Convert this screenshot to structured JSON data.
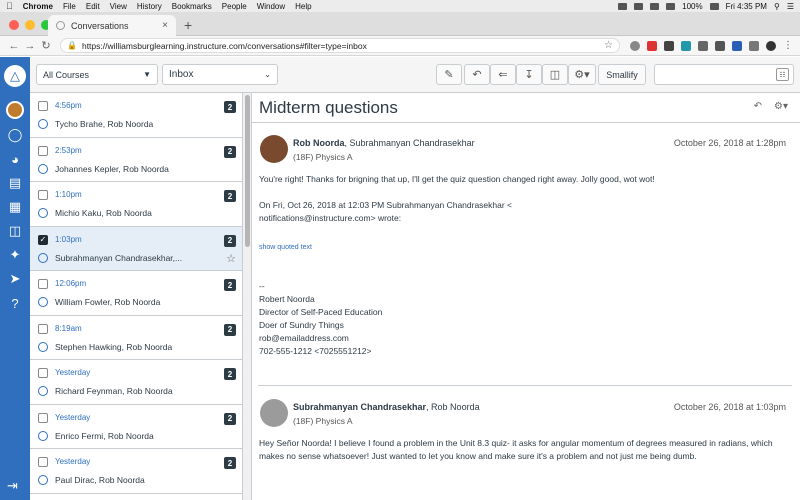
{
  "menubar": {
    "app": "Chrome",
    "items": [
      "File",
      "Edit",
      "View",
      "History",
      "Bookmarks",
      "People",
      "Window",
      "Help"
    ],
    "battery": "100%",
    "clock": "Fri 4:35 PM"
  },
  "browser": {
    "tab_title": "Conversations",
    "url": "https://williamsburglearning.instructure.com/conversations#filter=type=inbox"
  },
  "toolbar": {
    "course_filter": "All Courses",
    "mailbox_filter": "Inbox",
    "smallify_label": "Smallify",
    "search_placeholder": ""
  },
  "conversations": [
    {
      "time": "4:56pm",
      "names": "Tycho Brahe, Rob Noorda",
      "count": "2"
    },
    {
      "time": "2:53pm",
      "names": "Johannes Kepler, Rob Noorda",
      "count": "2"
    },
    {
      "time": "1:10pm",
      "names": "Michio Kaku, Rob Noorda",
      "count": "2"
    },
    {
      "time": "1:03pm",
      "names": "Subrahmanyan Chandrasekhar,...",
      "count": "2"
    },
    {
      "time": "12:06pm",
      "names": "William Fowler, Rob Noorda",
      "count": "2"
    },
    {
      "time": "8:19am",
      "names": "Stephen Hawking, Rob Noorda",
      "count": "2"
    },
    {
      "time": "Yesterday",
      "names": "Richard Feynman, Rob Noorda",
      "count": "2"
    },
    {
      "time": "Yesterday",
      "names": "Enrico Fermi, Rob Noorda",
      "count": "2"
    },
    {
      "time": "Yesterday",
      "names": "Paul Dirac, Rob Noorda",
      "count": "2"
    }
  ],
  "detail": {
    "subject": "Midterm questions",
    "messages": [
      {
        "author": "Rob Noorda",
        "recipients": ", Subrahmanyan Chandrasekhar",
        "course": "(18F) Physics A",
        "date": "October 26, 2018 at 1:28pm",
        "text": "You're right! Thanks for brigning that up, I'll get the quiz question changed right away. Jolly good, wot wot!",
        "quote_header_1": "On Fri, Oct 26, 2018 at 12:03 PM Subrahmanyan Chandrasekhar <",
        "quote_header_2": "notifications@instructure.com> wrote:",
        "show_quoted": "show quoted text",
        "sig_dash": "--",
        "sig_name": "Robert Noorda",
        "sig_title": "Director of Self-Paced Education",
        "sig_role": "Doer of Sundry Things",
        "sig_email": "rob@emailaddress.com",
        "sig_phone": "702-555-1212 <7025551212>"
      },
      {
        "author": "Subrahmanyan Chandrasekhar",
        "recipients": ", Rob Noorda",
        "course": "(18F) Physics A",
        "date": "October 26, 2018 at 1:03pm",
        "text": "Hey Señor Noorda! I believe I found a problem in the Unit 8.3 quiz- it asks for angular momentum of degrees measured in radians, which makes no sense whatsoever! Just wanted to let you know and make sure it's a problem and not just me being dumb."
      }
    ]
  },
  "colors": {
    "canvas_blue": "#2f6fbd",
    "selected_row": "#e5eef7",
    "text": "#2d3b45"
  }
}
